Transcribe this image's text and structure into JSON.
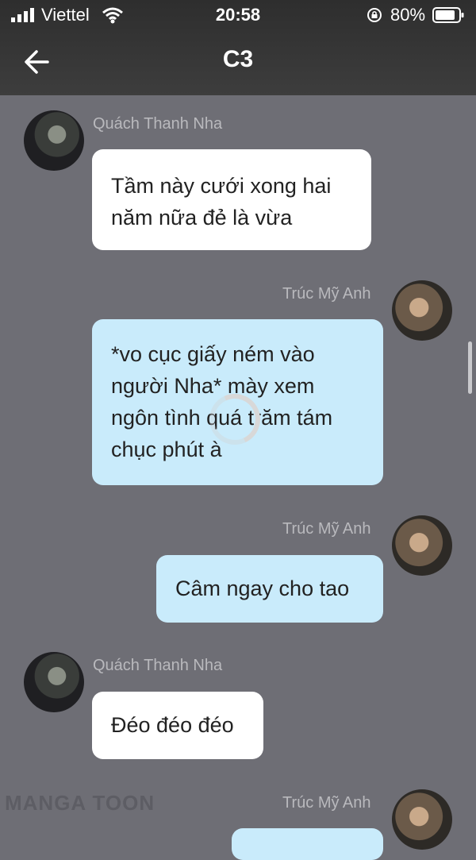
{
  "status_bar": {
    "carrier": "Viettel",
    "time": "20:58",
    "battery": "80%"
  },
  "header": {
    "title": "C3",
    "icons": [
      "back-arrow-icon"
    ]
  },
  "messages": [
    {
      "sender": "Quách Thanh Nha",
      "side": "left",
      "text_lines": [
        "Tầm này cưới xong hai",
        "năm nữa đẻ là vừa"
      ]
    },
    {
      "sender": "Trúc Mỹ Anh",
      "side": "right",
      "text_lines": [
        "*vo cục giấy ném vào",
        "người Nha* mày xem",
        "ngôn tình quá trăm tám",
        "chục phút à"
      ]
    },
    {
      "sender": "Trúc Mỹ Anh",
      "side": "right",
      "text_lines": [
        "Câm ngay cho tao"
      ]
    },
    {
      "sender": "Quách Thanh Nha",
      "side": "left",
      "text_lines": [
        "Đéo đéo đéo"
      ]
    },
    {
      "sender": "Trúc Mỹ Anh",
      "side": "right",
      "text_lines": []
    }
  ],
  "watermark": "MANGA TOON",
  "colors": {
    "header_bg": "#333333",
    "chat_bg": "#6e6e75",
    "bubble_left": "#ffffff",
    "bubble_right": "#c9ebfb"
  }
}
